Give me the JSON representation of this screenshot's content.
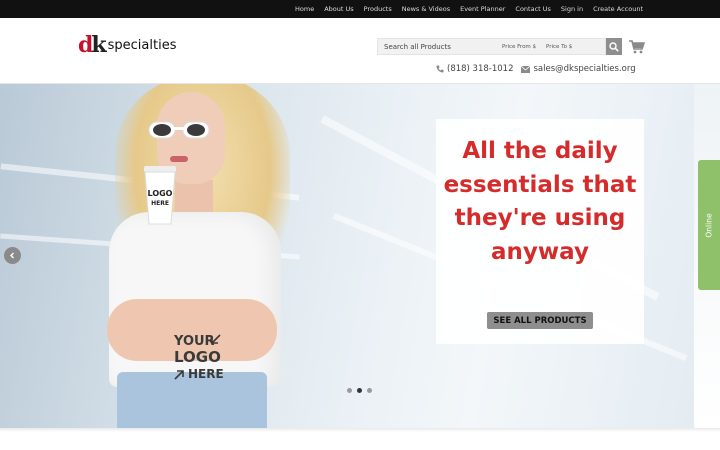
{
  "topnav": {
    "items": [
      "Home",
      "About Us",
      "Products",
      "News & Videos",
      "Event Planner",
      "Contact Us",
      "Sign in",
      "Create Account"
    ]
  },
  "logo": {
    "mark_d": "d",
    "mark_k": "k",
    "text": "specialties"
  },
  "search": {
    "placeholder": "Search all Products",
    "price_from_placeholder": "Price From $",
    "price_to_placeholder": "Price To $",
    "button_icon": "search-icon"
  },
  "cart": {
    "icon": "cart-icon"
  },
  "contact": {
    "phone": "(818) 318-1012",
    "email": "sales@dkspecialties.org",
    "phone_icon": "phone-icon",
    "email_icon": "envelope-icon"
  },
  "hero": {
    "headline": "All the daily essentials that they're using anyway",
    "cta_label": "SEE ALL PRODUCTS",
    "shirt_logo_lines": [
      "YOUR",
      "LOGO",
      "HERE"
    ],
    "cup_logo_lines": [
      "LOGO",
      "HERE"
    ],
    "slides": 3,
    "active_slide": 2
  },
  "side_tab": {
    "label": "Online"
  },
  "colors": {
    "brand_red": "#d52b2b",
    "topbar": "#111111",
    "online_green": "#8fc16b",
    "button_gray": "#8e8e8e"
  }
}
